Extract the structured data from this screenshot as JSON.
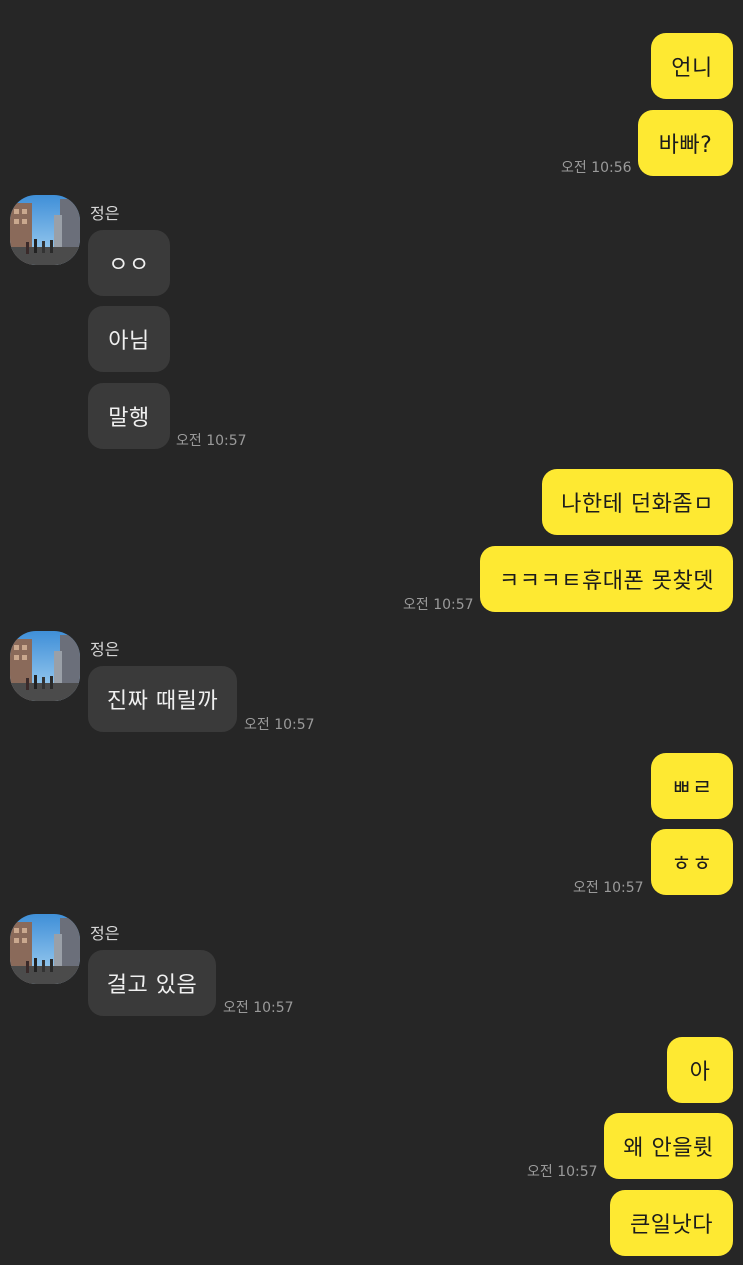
{
  "conversation": {
    "sender_name": "정은",
    "messages": [
      {
        "from": "me",
        "text": "언니"
      },
      {
        "from": "me",
        "text": "바빠?",
        "time": "오전 10:56"
      },
      {
        "from": "other",
        "text": "ㅇㅇ"
      },
      {
        "from": "other",
        "text": "아님"
      },
      {
        "from": "other",
        "text": "말행",
        "time": "오전 10:57"
      },
      {
        "from": "me",
        "text": "나한테 던화좀ㅁ"
      },
      {
        "from": "me",
        "text": "ㅋㅋㅋㅌ휴대폰 못찾뎃",
        "time": "오전 10:57"
      },
      {
        "from": "other",
        "text": "진짜 때릴까",
        "time": "오전 10:57"
      },
      {
        "from": "me",
        "text": "ㅃㄹ"
      },
      {
        "from": "me",
        "text": "ㅎㅎ",
        "time": "오전 10:57"
      },
      {
        "from": "other",
        "text": "걸고 있음",
        "time": "오전 10:57"
      },
      {
        "from": "me",
        "text": "아"
      },
      {
        "from": "me",
        "text": "왜 안을륏",
        "time": "오전 10:57"
      },
      {
        "from": "me",
        "text": "큰일낫다"
      }
    ]
  },
  "colors": {
    "background": "#262626",
    "my_bubble": "#FEE932",
    "their_bubble": "#3a3a3a",
    "timestamp": "#9a9a9a"
  },
  "icons": {
    "avatar": "profile-photo-street-icon"
  }
}
